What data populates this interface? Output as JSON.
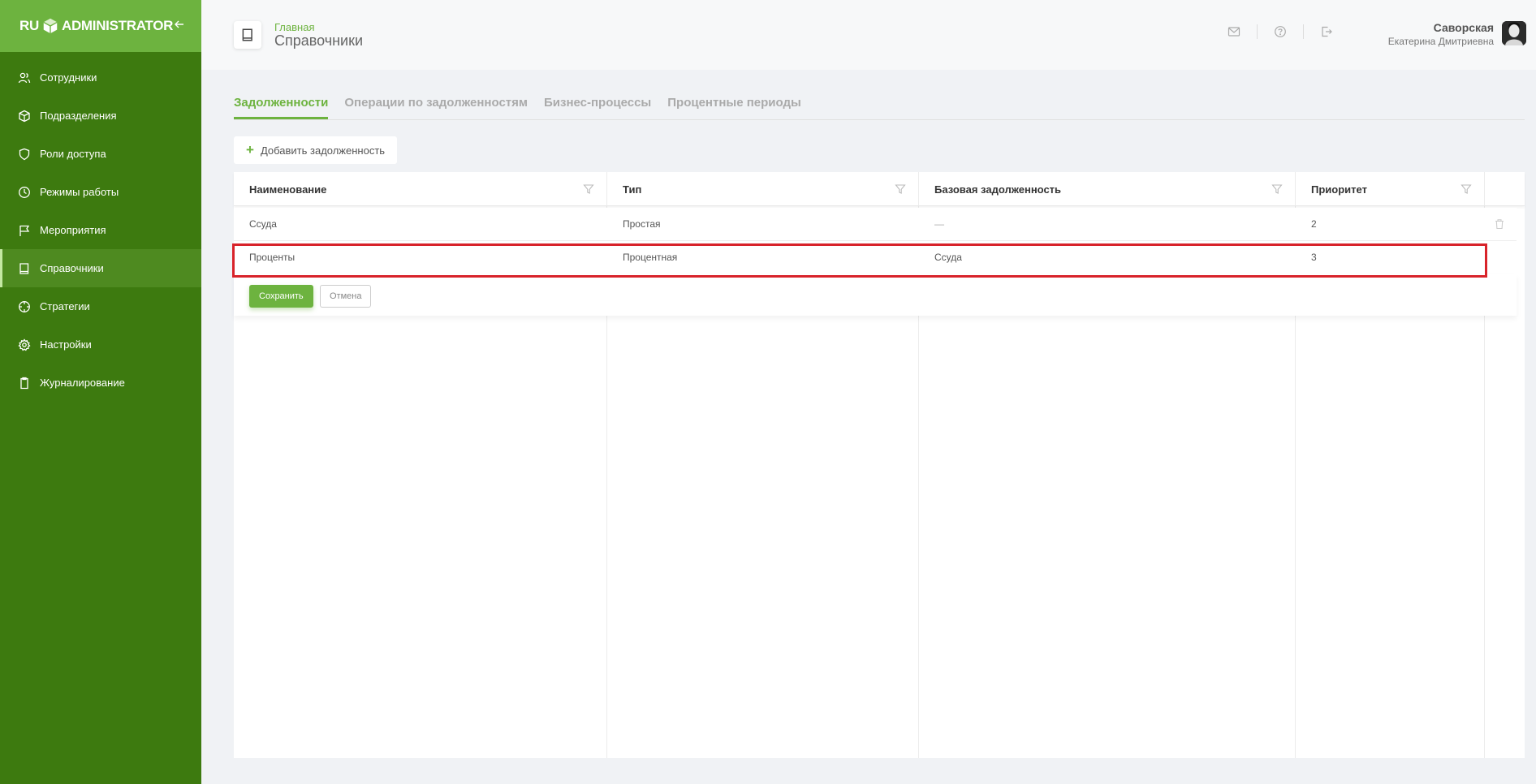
{
  "app": {
    "logo_left": "RU",
    "logo_right": "ADMINISTRATOR"
  },
  "sidebar": {
    "items": [
      {
        "label": "Сотрудники",
        "icon": "users-icon"
      },
      {
        "label": "Подразделения",
        "icon": "cube-icon"
      },
      {
        "label": "Роли доступа",
        "icon": "shield-icon"
      },
      {
        "label": "Режимы работы",
        "icon": "clock-icon"
      },
      {
        "label": "Мероприятия",
        "icon": "flag-icon"
      },
      {
        "label": "Справочники",
        "icon": "book-icon",
        "active": true
      },
      {
        "label": "Стратегии",
        "icon": "crosshair-icon"
      },
      {
        "label": "Настройки",
        "icon": "gear-icon"
      },
      {
        "label": "Журналирование",
        "icon": "clipboard-icon"
      }
    ]
  },
  "header": {
    "breadcrumb": "Главная",
    "title": "Справочники"
  },
  "user": {
    "last_name": "Саворская",
    "first_name": "Екатерина Дмитриевна"
  },
  "tabs": [
    {
      "label": "Задолженности",
      "active": true
    },
    {
      "label": "Операции по задолженностям"
    },
    {
      "label": "Бизнес-процессы"
    },
    {
      "label": "Процентные периоды"
    }
  ],
  "add_button": "Добавить задолженность",
  "table": {
    "columns": [
      "Наименование",
      "Тип",
      "Базовая задолженность",
      "Приоритет"
    ],
    "rows": [
      [
        "Ссуда",
        "Простая",
        "—",
        "2"
      ],
      [
        "Проценты",
        "Процентная",
        "Ссуда",
        "3"
      ]
    ]
  },
  "actions": {
    "save": "Сохранить",
    "cancel": "Отмена"
  },
  "colors": {
    "sidebar": "#3d7a0f",
    "accent": "#6db33f",
    "highlight": "#d8232a"
  }
}
